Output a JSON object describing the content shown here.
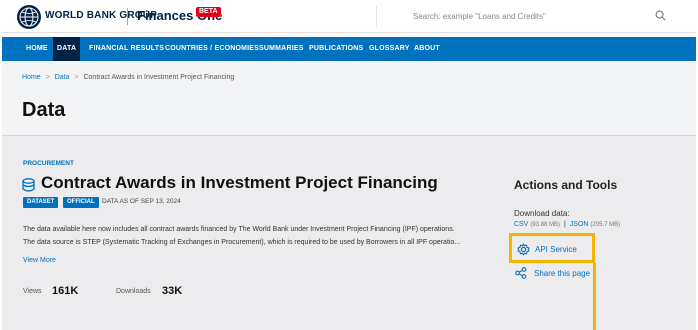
{
  "header": {
    "brand": "WORLD BANK GROUP",
    "product": "Finances One",
    "beta_badge": "BETA",
    "search_placeholder": "Search: example \"Loans and Credits\""
  },
  "nav": {
    "items": [
      "HOME",
      "DATA",
      "FINANCIAL RESULTS",
      "COUNTRIES / ECONOMIES",
      "SUMMARIES",
      "PUBLICATIONS",
      "GLOSSARY",
      "ABOUT"
    ],
    "active": "DATA"
  },
  "breadcrumb": {
    "items": [
      "Home",
      "Data",
      "Contract Awards in Investment Project Financing"
    ],
    "separator": ">"
  },
  "page_title": "Data",
  "dataset": {
    "category": "PROCUREMENT",
    "title": "Contract Awards in Investment Project Financing",
    "badges": [
      "DATASET",
      "OFFICIAL"
    ],
    "as_of": "DATA AS OF SEP 13, 2024",
    "description_line1": "The data available here now includes all contract awards financed by The World Bank under Investment Project Financing (IPF) operations.",
    "description_line2": "The data source is STEP (Systematic Tracking of Exchanges in Procurement), which is required to be used by Borrowers in all IPF operatio...",
    "view_more": "View More",
    "views_label": "Views",
    "views_value": "161K",
    "downloads_label": "Downloads",
    "downloads_value": "33K"
  },
  "actions": {
    "title": "Actions and Tools",
    "download_label": "Download data:",
    "csv_label": "CSV",
    "csv_size": "(93.88 MB)",
    "pipe": "|",
    "json_label": "JSON",
    "json_size": "(205.7 MB)",
    "api_label": "API Service",
    "share_label": "Share this page"
  },
  "colors": {
    "brand_navy": "#002244",
    "nav_blue": "#0071bc",
    "highlight": "#f5b400",
    "beta_red": "#e2001a"
  },
  "icons": {
    "logo": "world-bank-globe-icon",
    "search": "search-icon",
    "dataset": "database-icon",
    "api": "gear-icon",
    "share": "share-icon"
  }
}
